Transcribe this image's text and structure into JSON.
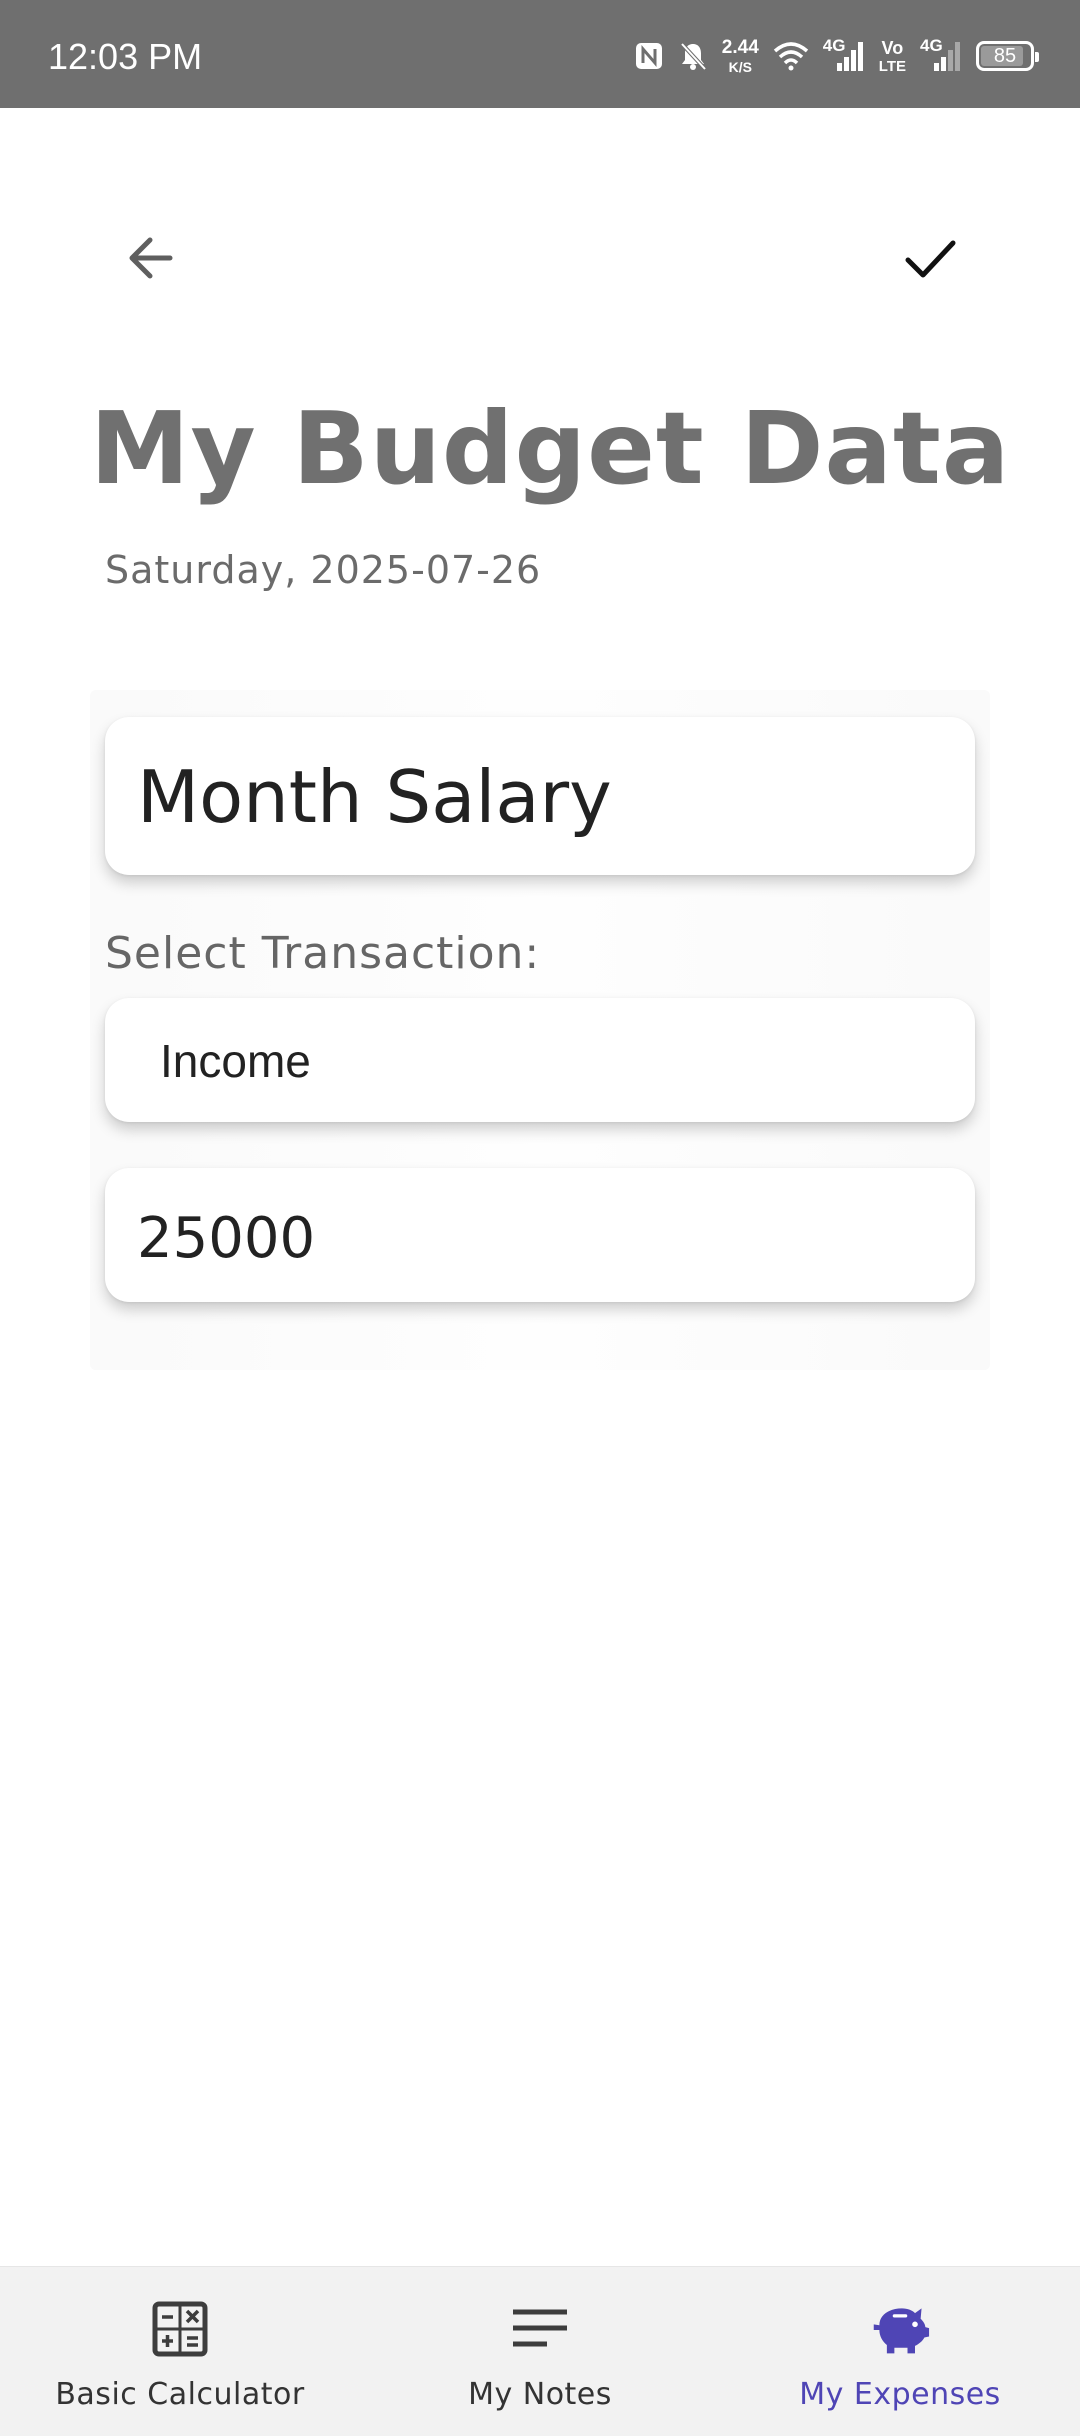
{
  "status_bar": {
    "time": "12:03 PM",
    "net_speed_value": "2.44",
    "net_speed_unit": "K/S",
    "signal1_label": "4G",
    "volte_top": "Vo",
    "volte_bottom": "LTE",
    "signal2_label": "4G",
    "battery": "85",
    "icons": [
      "nfc-icon",
      "bell-off-icon",
      "wifi-icon",
      "signal-icon",
      "signal-weak-icon",
      "battery-icon"
    ]
  },
  "toolbar": {
    "back_icon": "arrow-left-icon",
    "save_icon": "check-icon"
  },
  "page": {
    "title": "My Budget Data",
    "date": "Saturday, 2025-07-26"
  },
  "form": {
    "title_value": "Month Salary",
    "transaction_label": "Select Transaction:",
    "transaction_value": "Income",
    "amount_value": "25000"
  },
  "bottom_nav": {
    "items": [
      {
        "label": "Basic Calculator",
        "icon": "calculator-icon",
        "active": false
      },
      {
        "label": "My Notes",
        "icon": "notes-icon",
        "active": false
      },
      {
        "label": "My Expenses",
        "icon": "piggy-bank-icon",
        "active": true
      }
    ],
    "active_color": "#4f45b5",
    "inactive_color": "#333333"
  }
}
